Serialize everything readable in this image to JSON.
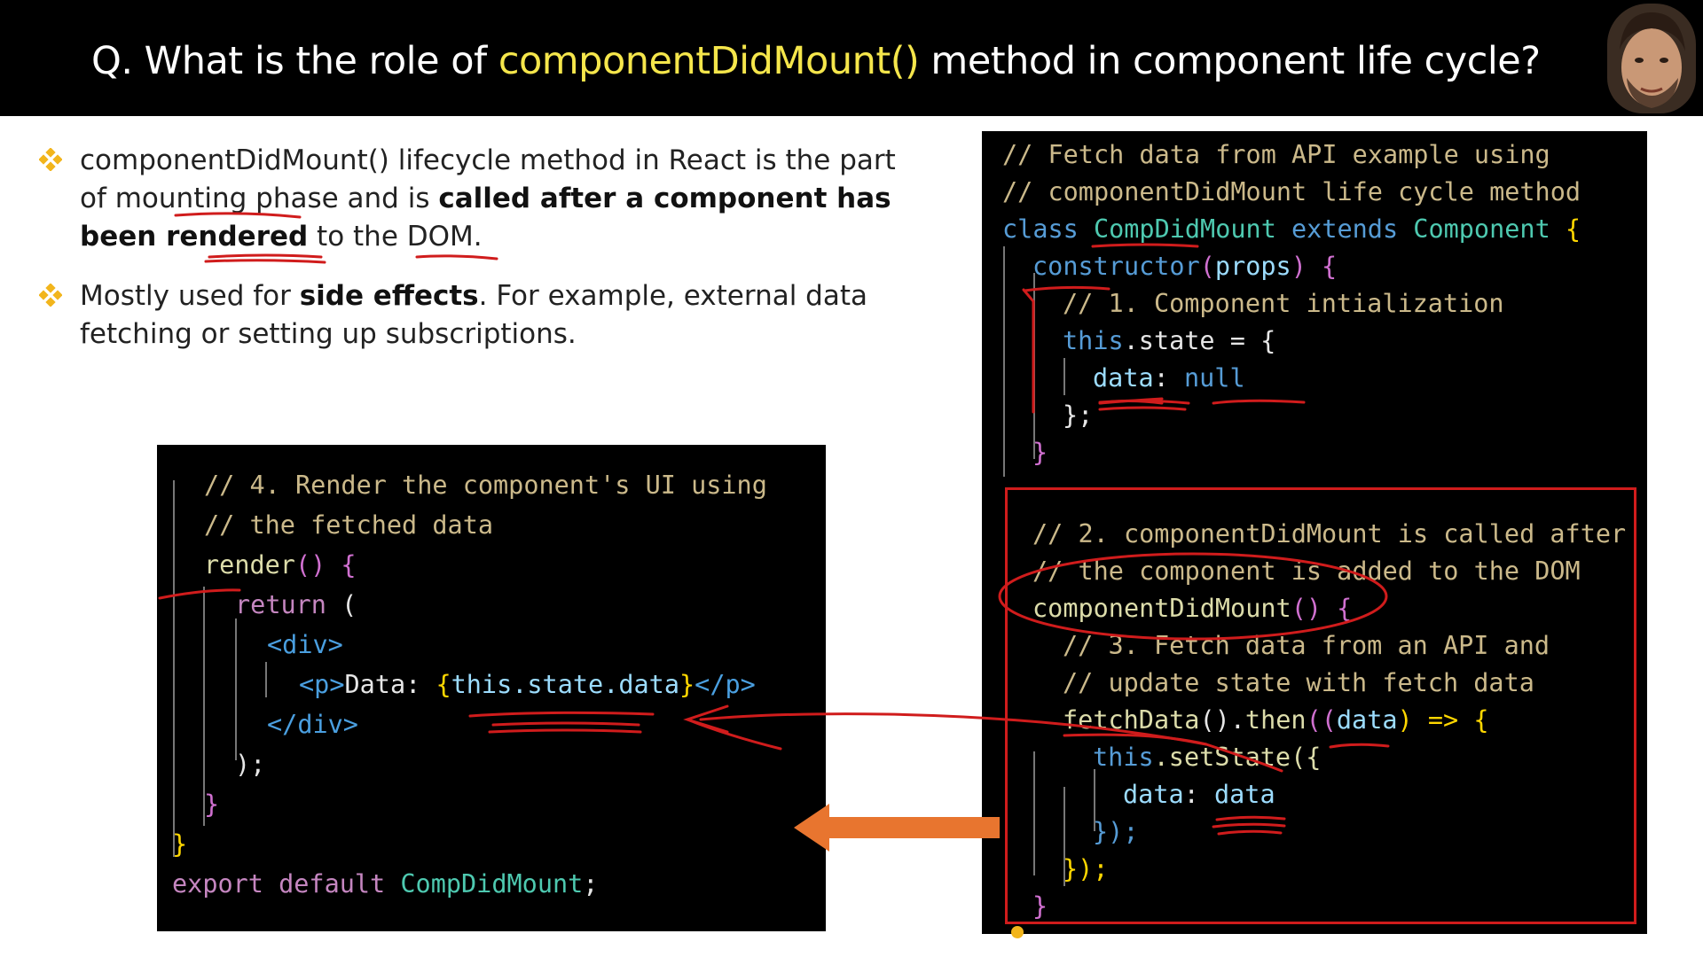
{
  "header": {
    "title_prefix": "Q. What is the role of ",
    "title_highlight": "componentDidMount()",
    "title_suffix": " method in component life cycle?",
    "highlight_color": "#f5e64b"
  },
  "bullets": [
    {
      "icon": "diamond-bullet-icon",
      "t1": "componentDidMount() lifecycle method in React is the part of mounting phase and is ",
      "b1": "called after a component has been rendered",
      "t2": " to the DOM."
    },
    {
      "icon": "diamond-bullet-icon",
      "t1": "Mostly used for ",
      "b1": "side effects",
      "t2": ". For example, external data fetching or setting up subscriptions."
    }
  ],
  "right_code": {
    "l1": "// Fetch data from API example using",
    "l2": "// componentDidMount life cycle method",
    "l3_kw": "class ",
    "l3_cls": "CompDidMount",
    "l3_ext": " extends ",
    "l3_base": "Component",
    "l3_brace": "{",
    "l4_kw": "constructor",
    "l4_paren": "(",
    "l4_arg": "props",
    "l4_end": ") {",
    "l5": "// 1. Component intialization",
    "l6_kw": "this",
    "l6_rest": ".state = {",
    "l7_key": "data",
    "l7_colon": ": ",
    "l7_val": "null",
    "l8": "};",
    "l9": "}",
    "l10": "// 2. componentDidMount is called after",
    "l11": "// the component is added to the DOM",
    "l12_fn": "componentDidMount",
    "l12_rest": "() {",
    "l13": "// 3. Fetch data from an API and",
    "l14": "// update state with fetch data",
    "l15_fn": "fetchData",
    "l15_a": "().",
    "l15_then": "then",
    "l15_b": "((",
    "l15_arg": "data",
    "l15_c": ") => {",
    "l16_kw": "this",
    "l16_rest": ".setState({",
    "l17_key": "data",
    "l17_colon": ": ",
    "l17_val": "data",
    "l18": "});",
    "l19": "});",
    "l20": "}"
  },
  "left_code": {
    "l1": "// 4. Render the component's UI using",
    "l2": "// the fetched data",
    "l3_fn": "render",
    "l3_rest": "() {",
    "l4_kw": "return",
    "l4_rest": " (",
    "l5": "<div>",
    "l6_open": "<p>",
    "l6_text": "Data: ",
    "l6_ob": "{",
    "l6_expr": "this.state.data",
    "l6_cb": "}",
    "l6_close": "</p>",
    "l7": "</div>",
    "l8": ");",
    "l9": "}",
    "l10": "}",
    "l11_kw": "export default ",
    "l11_cls": "CompDidMount",
    "l11_end": ";"
  },
  "colors": {
    "red_annotation": "#d01c1c",
    "orange_arrow": "#e8752f",
    "comment": "#cbb98a"
  }
}
